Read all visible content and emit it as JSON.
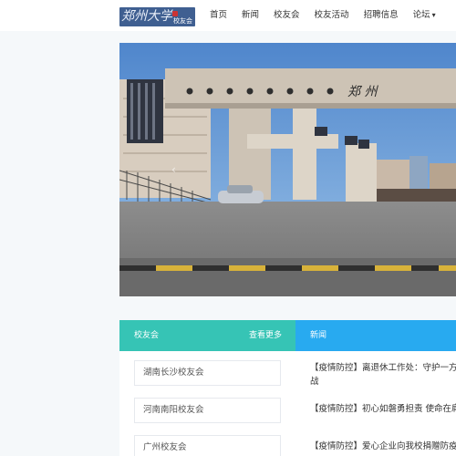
{
  "header": {
    "logo": {
      "main": "郑州大学",
      "sub": "校友会"
    },
    "nav": [
      {
        "label": "首页"
      },
      {
        "label": "新闻"
      },
      {
        "label": "校友会"
      },
      {
        "label": "校友活动"
      },
      {
        "label": "招聘信息"
      },
      {
        "label": "论坛"
      }
    ]
  },
  "banner": {
    "gate_sign": "郑 州"
  },
  "alumni": {
    "title": "校友会",
    "more": "查看更多",
    "items": [
      "湖南长沙校友会",
      "河南南阳校友会",
      "广州校友会"
    ]
  },
  "news": {
    "title": "新闻",
    "items": [
      "【疫情防控】离退休工作处：守护一方，",
      "战",
      "【疫情防控】初心如磐勇担责 使命在肩",
      "【疫情防控】爱心企业向我校捐赠防疫物"
    ]
  },
  "colors": {
    "alumni_accent": "#36c4b5",
    "news_accent": "#28aaf0",
    "logo_bg": "#3f5f91"
  }
}
